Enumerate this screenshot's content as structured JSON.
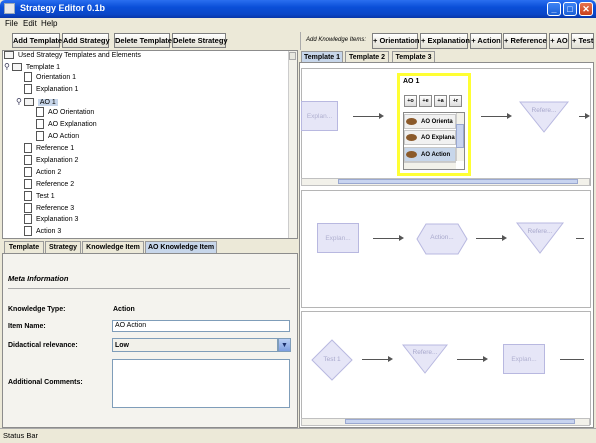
{
  "window": {
    "title": "Strategy Editor 0.1b",
    "minimize": "_",
    "maximize": "□",
    "close": "✕"
  },
  "menu": [
    "File",
    "Edit",
    "Help"
  ],
  "left_toolbar": [
    "Add Template",
    "Add Strategy",
    "Delete Template",
    "Delete Strategy"
  ],
  "right_toolbar": {
    "label": "Add Knowledge Items:",
    "buttons": [
      "+ Orientation",
      "+ Explanation",
      "+ Action",
      "+ Reference",
      "+ AO",
      "+ Test"
    ]
  },
  "tree": {
    "root": "Used Strategy Templates and Elements",
    "template": "Template 1",
    "items": [
      "Orientation 1",
      "Explanation 1"
    ],
    "ao": "AO 1",
    "ao_children": [
      "AO Orientation",
      "AO Explanation",
      "AO Action"
    ],
    "rest": [
      "Reference 1",
      "Explanation 2",
      "Action 2",
      "Reference 2",
      "Test 1",
      "Reference 3",
      "Explanation 3",
      "Action 3"
    ]
  },
  "bottom_tabs": [
    "Template",
    "Strategy",
    "Knowledge Item",
    "AO Knowledge Item"
  ],
  "form": {
    "section": "Meta Information",
    "knowledge_type_label": "Knowledge Type:",
    "knowledge_type_value": "Action",
    "item_name_label": "Item Name:",
    "item_name_value": "AO Action",
    "didactical_label": "Didactical relevance:",
    "didactical_value": "Low",
    "comments_label": "Additional Comments:",
    "comments_value": ""
  },
  "right_tabs": [
    "Template 1",
    "Template 2",
    "Template 3"
  ],
  "graph1": {
    "left_node": "Explan...",
    "right_node": "Refere..."
  },
  "ao_box": {
    "title": "AO 1",
    "mini_buttons": [
      "+o",
      "+e",
      "+a",
      "+r"
    ],
    "items": [
      "AO Orienta",
      "AO Explana",
      "AO Action"
    ]
  },
  "graph2": [
    "Explan...",
    "Action...",
    "Refere..."
  ],
  "graph3": [
    "Test 1",
    "Refere...",
    "Explan..."
  ],
  "status": "Status Bar"
}
